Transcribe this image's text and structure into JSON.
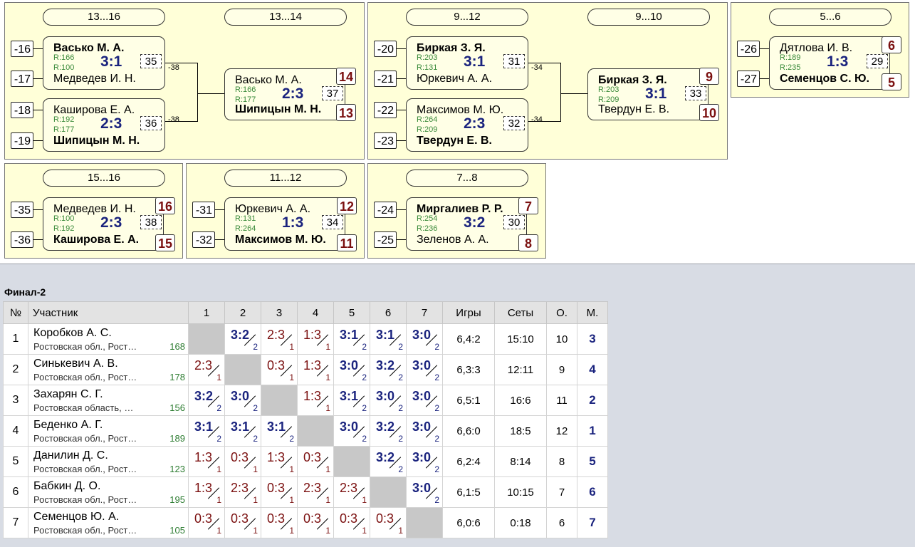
{
  "bracket": {
    "p1316": {
      "title": "13...16",
      "title2": "13...14",
      "m1": {
        "seed1": "-16",
        "seed2": "-17",
        "p1": "Васько М. А.",
        "p2": "Медведев И. Н.",
        "r1": "R:166",
        "r2": "R:100",
        "score": "3:1",
        "num": "35",
        "out": "-38"
      },
      "m2": {
        "seed1": "-18",
        "seed2": "-19",
        "p1": "Каширова Е. А.",
        "p2": "Шипицын М. Н.",
        "r1": "R:192",
        "r2": "R:177",
        "score": "2:3",
        "num": "36",
        "out": "-38"
      },
      "m3": {
        "p1": "Васько М. А.",
        "p2": "Шипицын М. Н.",
        "r1": "R:166",
        "r2": "R:177",
        "score": "2:3",
        "num": "37",
        "b1": "14",
        "b2": "13"
      }
    },
    "p912": {
      "title": "9...12",
      "title2": "9...10",
      "m1": {
        "seed1": "-20",
        "seed2": "-21",
        "p1": "Биркая З. Я.",
        "p2": "Юркевич А. А.",
        "r1": "R:203",
        "r2": "R:131",
        "score": "3:1",
        "num": "31",
        "out": "-34"
      },
      "m2": {
        "seed1": "-22",
        "seed2": "-23",
        "p1": "Максимов М. Ю.",
        "p2": "Твердун Е. В.",
        "r1": "R:264",
        "r2": "R:209",
        "score": "2:3",
        "num": "32",
        "out": "-34"
      },
      "m3": {
        "p1": "Биркая З. Я.",
        "p2": "Твердун Е. В.",
        "r1": "R:203",
        "r2": "R:209",
        "score": "3:1",
        "num": "33",
        "b1": "9",
        "b2": "10"
      }
    },
    "p56": {
      "title": "5...6",
      "m1": {
        "seed1": "-26",
        "seed2": "-27",
        "p1": "Дятлова И. В.",
        "p2": "Семенцов С. Ю.",
        "r1": "R:189",
        "r2": "R:235",
        "score": "1:3",
        "num": "29",
        "b1": "6",
        "b2": "5"
      }
    },
    "p1516": {
      "title": "15...16",
      "m1": {
        "seed1": "-35",
        "seed2": "-36",
        "p1": "Медведев И. Н.",
        "p2": "Каширова Е. А.",
        "r1": "R:100",
        "r2": "R:192",
        "score": "2:3",
        "num": "38",
        "b1": "16",
        "b2": "15"
      }
    },
    "p1112": {
      "title": "11...12",
      "m1": {
        "seed1": "-31",
        "seed2": "-32",
        "p1": "Юркевич А. А.",
        "p2": "Максимов М. Ю.",
        "r1": "R:131",
        "r2": "R:264",
        "score": "1:3",
        "num": "34",
        "b1": "12",
        "b2": "11"
      }
    },
    "p78": {
      "title": "7...8",
      "m1": {
        "seed1": "-24",
        "seed2": "-25",
        "p1": "Миргалиев Р. Р.",
        "p2": "Зеленов А. А.",
        "r1": "R:254",
        "r2": "R:236",
        "score": "3:2",
        "num": "30",
        "b1": "7",
        "b2": "8"
      }
    }
  },
  "final": {
    "title": "Финал-2",
    "headers": [
      "№",
      "Участник",
      "1",
      "2",
      "3",
      "4",
      "5",
      "6",
      "7",
      "Игры",
      "Сеты",
      "О.",
      "М."
    ],
    "rows": [
      {
        "n": "1",
        "name": "Коробков А. С.",
        "region": "Ростовская обл., Рост…",
        "rating": "168",
        "cells": [
          null,
          [
            "3:2",
            "2",
            "w"
          ],
          [
            "2:3",
            "1",
            "l"
          ],
          [
            "1:3",
            "1",
            "l"
          ],
          [
            "3:1",
            "2",
            "w"
          ],
          [
            "3:1",
            "2",
            "w"
          ],
          [
            "3:0",
            "2",
            "w"
          ]
        ],
        "games": "6,4:2",
        "sets": "15:10",
        "pts": "10",
        "place": "3"
      },
      {
        "n": "2",
        "name": "Синькевич А. В.",
        "region": "Ростовская обл., Рост…",
        "rating": "178",
        "cells": [
          [
            "2:3",
            "1",
            "l"
          ],
          null,
          [
            "0:3",
            "1",
            "l"
          ],
          [
            "1:3",
            "1",
            "l"
          ],
          [
            "3:0",
            "2",
            "w"
          ],
          [
            "3:2",
            "2",
            "w"
          ],
          [
            "3:0",
            "2",
            "w"
          ]
        ],
        "games": "6,3:3",
        "sets": "12:11",
        "pts": "9",
        "place": "4"
      },
      {
        "n": "3",
        "name": "Захарян С. Г.",
        "region": "Ростовская область, …",
        "rating": "156",
        "cells": [
          [
            "3:2",
            "2",
            "w"
          ],
          [
            "3:0",
            "2",
            "w"
          ],
          null,
          [
            "1:3",
            "1",
            "l"
          ],
          [
            "3:1",
            "2",
            "w"
          ],
          [
            "3:0",
            "2",
            "w"
          ],
          [
            "3:0",
            "2",
            "w"
          ]
        ],
        "games": "6,5:1",
        "sets": "16:6",
        "pts": "11",
        "place": "2"
      },
      {
        "n": "4",
        "name": "Беденко А. Г.",
        "region": "Ростовская обл., Рост…",
        "rating": "189",
        "cells": [
          [
            "3:1",
            "2",
            "w"
          ],
          [
            "3:1",
            "2",
            "w"
          ],
          [
            "3:1",
            "2",
            "w"
          ],
          null,
          [
            "3:0",
            "2",
            "w"
          ],
          [
            "3:2",
            "2",
            "w"
          ],
          [
            "3:0",
            "2",
            "w"
          ]
        ],
        "games": "6,6:0",
        "sets": "18:5",
        "pts": "12",
        "place": "1"
      },
      {
        "n": "5",
        "name": "Данилин Д. С.",
        "region": "Ростовская обл., Рост…",
        "rating": "123",
        "cells": [
          [
            "1:3",
            "1",
            "l"
          ],
          [
            "0:3",
            "1",
            "l"
          ],
          [
            "1:3",
            "1",
            "l"
          ],
          [
            "0:3",
            "1",
            "l"
          ],
          null,
          [
            "3:2",
            "2",
            "w"
          ],
          [
            "3:0",
            "2",
            "w"
          ]
        ],
        "games": "6,2:4",
        "sets": "8:14",
        "pts": "8",
        "place": "5"
      },
      {
        "n": "6",
        "name": "Бабкин Д. О.",
        "region": "Ростовская обл., Рост…",
        "rating": "195",
        "cells": [
          [
            "1:3",
            "1",
            "l"
          ],
          [
            "2:3",
            "1",
            "l"
          ],
          [
            "0:3",
            "1",
            "l"
          ],
          [
            "2:3",
            "1",
            "l"
          ],
          [
            "2:3",
            "1",
            "l"
          ],
          null,
          [
            "3:0",
            "2",
            "w"
          ]
        ],
        "games": "6,1:5",
        "sets": "10:15",
        "pts": "7",
        "place": "6"
      },
      {
        "n": "7",
        "name": "Семенцов Ю. А.",
        "region": "Ростовская обл., Рост…",
        "rating": "105",
        "cells": [
          [
            "0:3",
            "1",
            "l"
          ],
          [
            "0:3",
            "1",
            "l"
          ],
          [
            "0:3",
            "1",
            "l"
          ],
          [
            "0:3",
            "1",
            "l"
          ],
          [
            "0:3",
            "1",
            "l"
          ],
          [
            "0:3",
            "1",
            "l"
          ],
          null
        ],
        "games": "6,0:6",
        "sets": "0:18",
        "pts": "6",
        "place": "7"
      }
    ]
  }
}
